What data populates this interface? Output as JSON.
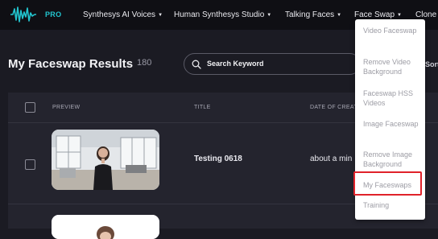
{
  "nav": {
    "logo_text": "PRO",
    "items": [
      {
        "label": "Synthesys AI Voices"
      },
      {
        "label": "Human Synthesys Studio"
      },
      {
        "label": "Talking Faces"
      },
      {
        "label": "Face Swap"
      },
      {
        "label": "Clone V"
      }
    ]
  },
  "page": {
    "title": "My Faceswap Results",
    "count": "180",
    "search_placeholder": "Search Keyword",
    "sort_label": "Sort"
  },
  "table": {
    "headers": [
      "PREVIEW",
      "TITLE",
      "DATE OF CREAT"
    ],
    "rows": [
      {
        "title": "Testing 0618",
        "date": "about a min"
      }
    ]
  },
  "dropdown": {
    "items": [
      {
        "label": "Video Faceswap"
      },
      {
        "label": "Remove Video Background"
      },
      {
        "label": "Faceswap HSS Videos"
      },
      {
        "label": "Image Faceswap"
      },
      {
        "label": "Remove Image Background"
      },
      {
        "label": "My Faceswaps"
      },
      {
        "label": "Training"
      }
    ],
    "highlighted": "My Faceswaps"
  },
  "colors": {
    "accent": "#22c5cf",
    "navbar_bg": "#0f0f14",
    "page_bg": "#1b1b23",
    "highlight": "#e0222a"
  }
}
